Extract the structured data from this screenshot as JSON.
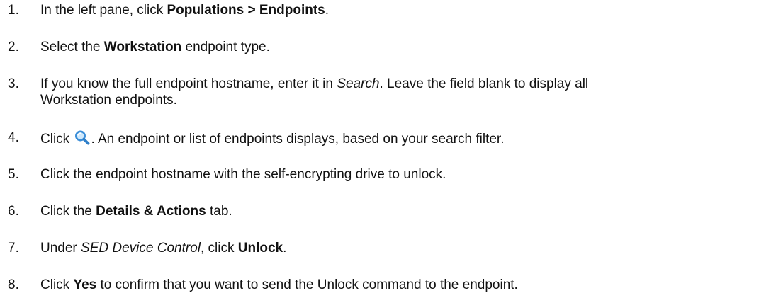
{
  "steps": [
    {
      "number": "1.",
      "parts": [
        {
          "t": "In the left pane, click "
        },
        {
          "t": "Populations > Endpoints",
          "b": true
        },
        {
          "t": "."
        }
      ]
    },
    {
      "number": "2.",
      "parts": [
        {
          "t": "Select the "
        },
        {
          "t": "Workstation",
          "b": true
        },
        {
          "t": " endpoint type."
        }
      ]
    },
    {
      "number": "3.",
      "parts": [
        {
          "t": "If you know the full endpoint hostname, enter it in "
        },
        {
          "t": "Search",
          "i": true
        },
        {
          "t": ". Leave the field blank to display all"
        }
      ],
      "line2": "Workstation endpoints."
    },
    {
      "number": "4.",
      "parts": [
        {
          "t": "Click "
        },
        {
          "icon": "search-icon"
        },
        {
          "t": ". An endpoint or list of endpoints displays, based on your search filter."
        }
      ]
    },
    {
      "number": "5.",
      "parts": [
        {
          "t": "Click the endpoint hostname with the self-encrypting drive to unlock."
        }
      ]
    },
    {
      "number": "6.",
      "parts": [
        {
          "t": "Click the "
        },
        {
          "t": "Details & Actions",
          "b": true
        },
        {
          "t": " tab."
        }
      ]
    },
    {
      "number": "7.",
      "parts": [
        {
          "t": "Under "
        },
        {
          "t": "SED Device Control",
          "i": true
        },
        {
          "t": ", click "
        },
        {
          "t": "Unlock",
          "b": true
        },
        {
          "t": "."
        }
      ]
    },
    {
      "number": "8.",
      "parts": [
        {
          "t": "Click "
        },
        {
          "t": "Yes",
          "b": true
        },
        {
          "t": " to confirm that you want to send the Unlock command to the endpoint."
        }
      ]
    }
  ],
  "colors": {
    "text": "#111111",
    "icon_blue": "#3b8ed8",
    "icon_light": "#a9d3f5"
  }
}
